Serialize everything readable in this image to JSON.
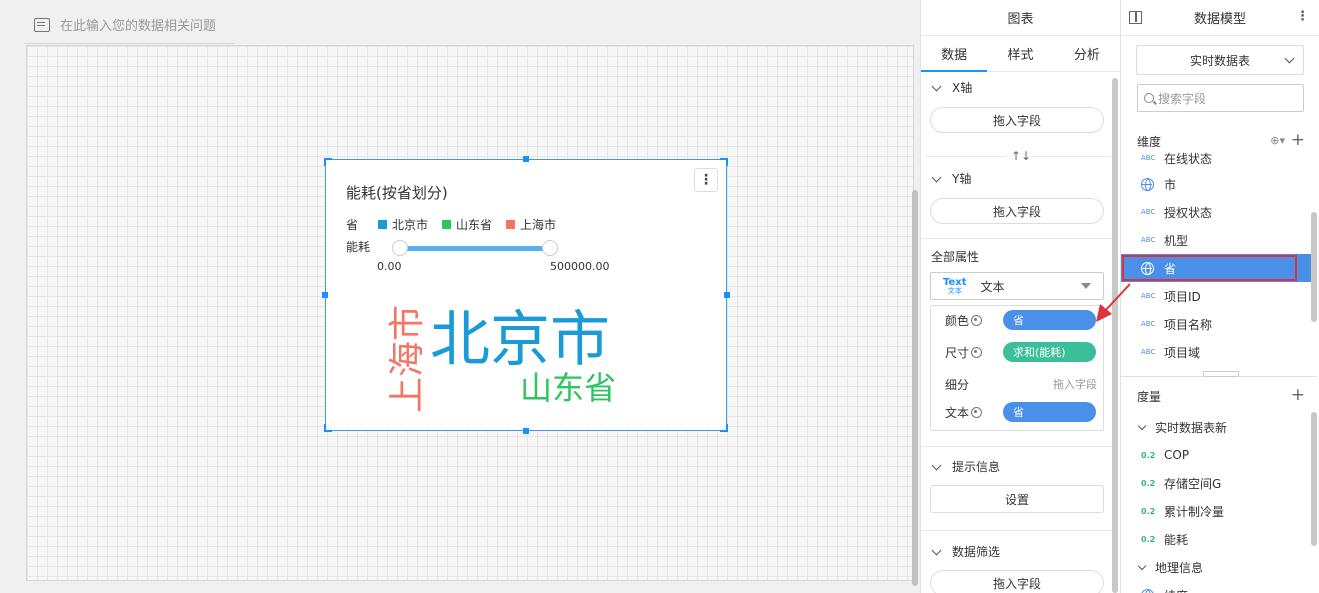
{
  "question_bar": {
    "placeholder": "在此输入您的数据相关问题"
  },
  "chart": {
    "title": "能耗(按省划分)",
    "legend_title": "省",
    "legend": [
      {
        "label": "北京市",
        "color": "#1a9ad6"
      },
      {
        "label": "山东省",
        "color": "#2ec45e"
      },
      {
        "label": "上海市",
        "color": "#f27565"
      }
    ],
    "range_label": "能耗",
    "range_min": "0.00",
    "range_max": "500000.00",
    "words": [
      {
        "text": "北京市",
        "color": "#1a9ad6"
      },
      {
        "text": "山东省",
        "color": "#2ec45e"
      },
      {
        "text": "上海市",
        "color": "#f27565"
      }
    ],
    "menu_glyph": "⋮"
  },
  "config_panel": {
    "header": "图表",
    "tabs": [
      "数据",
      "样式",
      "分析"
    ],
    "active_tab": "数据",
    "x_axis": {
      "title": "X轴",
      "drop_placeholder": "拖入字段"
    },
    "swap_glyph": "↑↓",
    "y_axis": {
      "title": "Y轴",
      "drop_placeholder": "拖入字段"
    },
    "all_props_title": "全部属性",
    "chart_type": {
      "badge_top": "Text",
      "badge_bottom": "文本",
      "label": "文本"
    },
    "mappings": [
      {
        "label": "颜色",
        "value": "省",
        "color": "#4a8fe8",
        "has_gear": true
      },
      {
        "label": "尺寸",
        "value": "求和(能耗)",
        "color": "#3bbf9a",
        "has_gear": true
      },
      {
        "label": "细分",
        "value": "",
        "placeholder": "拖入字段",
        "has_gear": false
      },
      {
        "label": "文本",
        "value": "省",
        "color": "#4a8fe8",
        "has_gear": true
      }
    ],
    "tooltip": {
      "title": "提示信息",
      "button": "设置"
    },
    "filter": {
      "title": "数据筛选",
      "drop_placeholder": "拖入字段"
    }
  },
  "model_panel": {
    "header": "数据模型",
    "dataset": "实时数据表",
    "search_placeholder": "搜索字段",
    "dimensions_title": "维度",
    "dimension_fields": [
      {
        "name": "在线状态",
        "type": "ABC"
      },
      {
        "name": "市",
        "type": "geo"
      },
      {
        "name": "授权状态",
        "type": "ABC"
      },
      {
        "name": "机型",
        "type": "ABC"
      },
      {
        "name": "省",
        "type": "geo",
        "selected": true
      },
      {
        "name": "项目ID",
        "type": "ABC"
      },
      {
        "name": "项目名称",
        "type": "ABC"
      },
      {
        "name": "项目域",
        "type": "ABC"
      }
    ],
    "measures_title": "度量",
    "measure_group": "实时数据表新",
    "measure_fields": [
      {
        "name": "COP",
        "type": "0.2"
      },
      {
        "name": "存储空间G",
        "type": "0.2"
      },
      {
        "name": "累计制冷量",
        "type": "0.2"
      },
      {
        "name": "能耗",
        "type": "0.2"
      }
    ],
    "geo_group": "地理信息",
    "geo_partial": "纬度"
  },
  "colors": {
    "accent": "#1890ff",
    "highlight": "#e0303a"
  }
}
